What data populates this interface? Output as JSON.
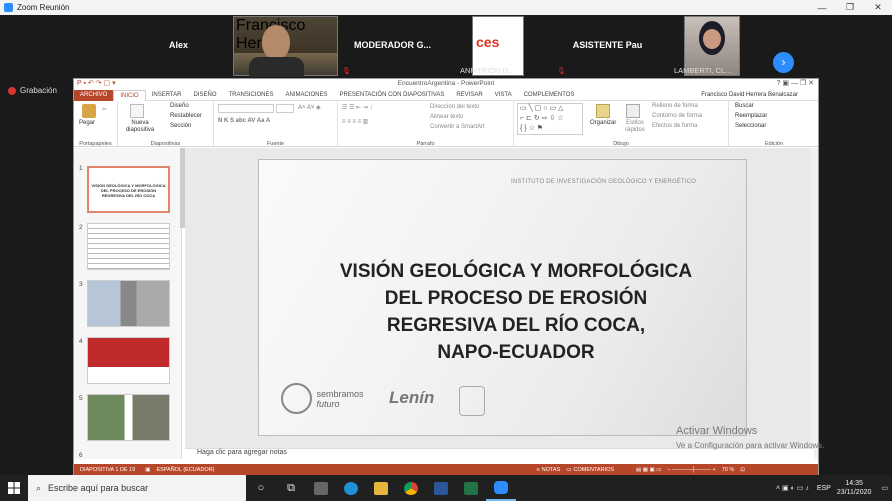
{
  "zoom": {
    "window_title": "Zoom Reunión",
    "recording_label": "Grabación",
    "participants": [
      {
        "name": "Alex",
        "label": ""
      },
      {
        "name": "",
        "label": "Francisco Herrera"
      },
      {
        "name": "MODERADOR G...",
        "label": ""
      },
      {
        "name": "",
        "label": "ANFITRIÓN D..."
      },
      {
        "name": "ASISTENTE Pau",
        "label": ""
      },
      {
        "name": "",
        "label": "LAMBERTI, CL..."
      }
    ],
    "next_icon": "chevron-right-icon"
  },
  "ppt": {
    "window_title": "EncuentroArgentina - PowerPoint",
    "user": "Francisco David Herrera Benalcazar",
    "tabs": [
      "ARCHIVO",
      "INICIO",
      "INSERTAR",
      "DISEÑO",
      "TRANSICIONES",
      "ANIMACIONES",
      "PRESENTACIÓN CON DIAPOSITIVAS",
      "REVISAR",
      "VISTA",
      "COMPLEMENTOS"
    ],
    "ribbon": {
      "paste": "Pegar",
      "new_slide": "Nueva diapositiva",
      "design": "Diseño",
      "reset": "Restablecer",
      "section": "Sección",
      "text_direction": "Dirección del texto",
      "align_text": "Alinear texto",
      "convert_smartart": "Convertir a SmartArt",
      "arrange": "Organizar",
      "quick_styles": "Estilos rápidos",
      "shape_fill": "Relleno de forma",
      "shape_outline": "Contorno de forma",
      "shape_effects": "Efectos de forma",
      "find": "Buscar",
      "replace": "Reemplazar",
      "select": "Seleccionar",
      "groups": {
        "clipboard": "Portapapeles",
        "slides": "Diapositivas",
        "font": "Fuente",
        "paragraph": "Párrafo",
        "drawing": "Dibujo",
        "editing": "Edición"
      }
    },
    "slide_numbers": [
      "1",
      "2",
      "3",
      "4",
      "5",
      "6"
    ],
    "slide": {
      "institute": "INSTITUTO DE INVESTIGACIÓN GEOLÓGICO Y ENERGÉTICO",
      "title_lines": [
        "VISIÓN GEOLÓGICA Y MORFOLÓGICA",
        "DEL PROCESO DE EROSIÓN",
        "REGRESIVA DEL RÍO COCA,",
        "NAPO-ECUADOR"
      ],
      "logo_text": "sembramos",
      "logo_sub": "futuro",
      "signature": "Lenín"
    },
    "notes_placeholder": "Haga clic para agregar notas",
    "status": {
      "slide_count": "DIAPOSITIVA 1 DE 19",
      "language": "ESPAÑOL (ECUADOR)",
      "notes": "NOTAS",
      "comments": "COMENTARIOS",
      "zoom": "70 %"
    }
  },
  "windows": {
    "watermark_title": "Activar Windows",
    "watermark_sub": "Ve a Configuración para activar Windows.",
    "search_placeholder": "Escribe aquí para buscar",
    "lang": "ESP",
    "time": "14:35",
    "date": "23/11/2020"
  }
}
